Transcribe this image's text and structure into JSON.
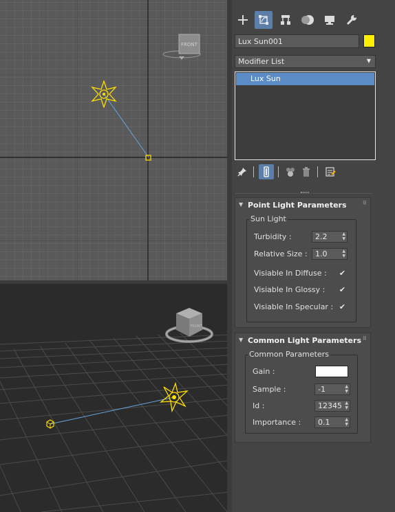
{
  "viewports": {
    "top": {
      "viewcube_label": "FRONT"
    },
    "perspective": {
      "viewcube_label": "FRONT"
    }
  },
  "tabs": [
    {
      "icon": "create-plus-icon"
    },
    {
      "icon": "modify-icon",
      "active": true
    },
    {
      "icon": "hierarchy-icon"
    },
    {
      "icon": "motion-icon"
    },
    {
      "icon": "display-icon"
    },
    {
      "icon": "utilities-wrench-icon"
    }
  ],
  "object": {
    "name": "Lux Sun001",
    "color": "#fff000"
  },
  "modifier_list": {
    "label": "Modifier List"
  },
  "stack": {
    "items": [
      "Lux Sun"
    ]
  },
  "point_light": {
    "title": "Point Light Parameters",
    "group_title": "Sun Light",
    "turbidity": {
      "label": "Turbidity :",
      "value": "2.2"
    },
    "relative_size": {
      "label": "Relative Size :",
      "value": "1.0"
    },
    "visible_diffuse": {
      "label": "Visiable In Diffuse :",
      "checked": true
    },
    "visible_glossy": {
      "label": "Visiable In Glossy :",
      "checked": true
    },
    "visible_specular": {
      "label": "Visiable In Specular :",
      "checked": true
    },
    "check_glyph": "✔"
  },
  "common_light": {
    "title": "Common Light Parameters",
    "group_title": "Common Parameters",
    "gain": {
      "label": "Gain :",
      "color": "#ffffff"
    },
    "sample": {
      "label": "Sample :",
      "value": "-1"
    },
    "id": {
      "label": "Id :",
      "value": "12345"
    },
    "importance": {
      "label": "Importance :",
      "value": "0.1"
    }
  }
}
